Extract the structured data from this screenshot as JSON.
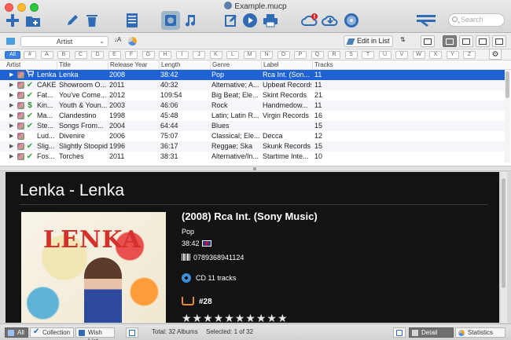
{
  "window": {
    "title": "Example.mucp"
  },
  "toolbar": {
    "search_placeholder": "Search",
    "buttons": [
      "add-icon",
      "folder-icon",
      "edit-icon",
      "trash-icon",
      "list-icon",
      "album-view-icon",
      "music-note-icon",
      "edit-form-icon",
      "play-icon",
      "print-icon",
      "cloud-sync-icon",
      "cloud-download-icon",
      "cd-icon",
      "settings-tools-icon"
    ]
  },
  "subbar": {
    "group_by": "Artist",
    "edit_in_list": "Edit in List"
  },
  "alphabar": {
    "letters": [
      "All",
      "#",
      "A",
      "B",
      "C",
      "D",
      "E",
      "F",
      "G",
      "H",
      "I",
      "J",
      "K",
      "L",
      "M",
      "N",
      "O",
      "P",
      "Q",
      "R",
      "S",
      "T",
      "U",
      "V",
      "W",
      "X",
      "Y",
      "Z"
    ],
    "active": "All"
  },
  "table": {
    "columns": [
      "Artist",
      "Title",
      "Release Year",
      "Length",
      "Genre",
      "Label",
      "Tracks"
    ],
    "rows": [
      {
        "status": "cart",
        "artist": "Lenka",
        "title": "Lenka",
        "year": "2008",
        "length": "38:42",
        "genre": "Pop",
        "label": "Rca Int. (Son...",
        "tracks": "11",
        "selected": true
      },
      {
        "status": "check",
        "artist": "CAKE",
        "title": "Showroom O...",
        "year": "2011",
        "length": "40:32",
        "genre": "Alternative; A...",
        "label": "Upbeat Records",
        "tracks": "11"
      },
      {
        "status": "check",
        "artist": "Fat...",
        "title": "You've Come...",
        "year": "2012",
        "length": "109:54",
        "genre": "Big Beat; Ele...",
        "label": "Skint Records",
        "tracks": "21"
      },
      {
        "status": "dollar",
        "artist": "Kin...",
        "title": "Youth & Youn...",
        "year": "2003",
        "length": "46:06",
        "genre": "Rock",
        "label": "Handmedow...",
        "tracks": "11"
      },
      {
        "status": "check",
        "artist": "Ma...",
        "title": "Clandestino",
        "year": "1998",
        "length": "45:48",
        "genre": "Latin; Latin R...",
        "label": "Virgin Records",
        "tracks": "16"
      },
      {
        "status": "check",
        "artist": "Ste...",
        "title": "Songs From...",
        "year": "2004",
        "length": "64:44",
        "genre": "Blues",
        "label": "",
        "tracks": "15"
      },
      {
        "status": "none",
        "artist": "Lud...",
        "title": "Divenire",
        "year": "2006",
        "length": "75:07",
        "genre": "Classical; Ele...",
        "label": "Decca",
        "tracks": "12"
      },
      {
        "status": "check",
        "artist": "Slig...",
        "title": "Slightly Stoopid",
        "year": "1996",
        "length": "36:17",
        "genre": "Reggae; Ska",
        "label": "Skunk Records",
        "tracks": "15"
      },
      {
        "status": "check",
        "artist": "Fos...",
        "title": "Torches",
        "year": "2011",
        "length": "38:31",
        "genre": "Alternative/In...",
        "label": "Startime Inte...",
        "tracks": "10"
      }
    ]
  },
  "detail": {
    "heading": "Lenka - Lenka",
    "cover_text": "LENKA",
    "year_label": "(2008)  Rca Int. (Sony Music)",
    "genre": "Pop",
    "length": "38:42",
    "barcode": "0789368941124",
    "media": "CD   11 tracks",
    "rank": "#28",
    "stars": "★★★★★★★★★★"
  },
  "bottombar": {
    "filters": [
      "All",
      "Collection",
      "Wish List"
    ],
    "total": "Total: 32 Albums",
    "selected": "Selected: 1 of 32",
    "views": [
      "Detail",
      "Statistics"
    ]
  }
}
